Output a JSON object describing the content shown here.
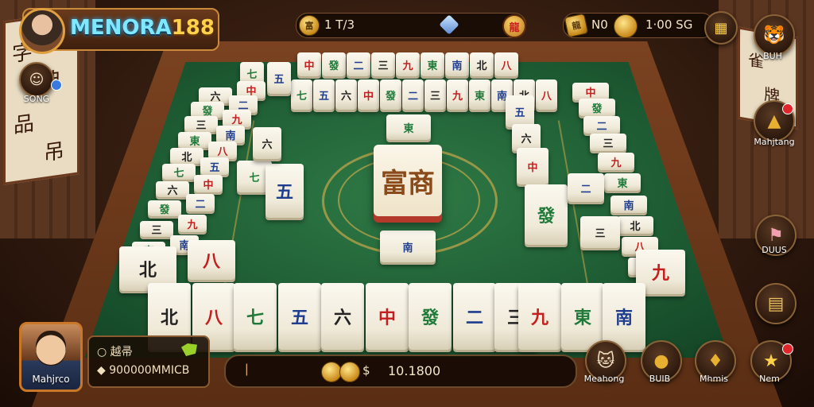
{
  "logo": {
    "text_a": "MENORA",
    "text_b": "188"
  },
  "top_hud": {
    "coin_icon_label": "富",
    "coins_text": "1 T/3",
    "rank_badge_label": "龍",
    "right_text_a": "龍",
    "right_text_b": "N0",
    "right_text_c": "1·00  SG"
  },
  "left_player": {
    "name": "SONG"
  },
  "right_menu": [
    {
      "label": "BUH",
      "icon": "tiger-mascot-icon"
    },
    {
      "label": "Mahjtang",
      "icon": "gold-ingot-icon"
    },
    {
      "label": "DUUS",
      "icon": "flag-icon"
    },
    {
      "label": "",
      "icon": "scroll-icon"
    }
  ],
  "bottom_buttons": [
    {
      "label": "Meahong",
      "icon": "lucky-cat-icon"
    },
    {
      "label": "BUIB",
      "icon": "gold-pouch-icon"
    },
    {
      "label": "Mhmis",
      "icon": "money-bag-icon"
    },
    {
      "label": "Nem",
      "icon": "star-icon"
    }
  ],
  "bottom_player": {
    "name": "Mahjrco"
  },
  "info_box": {
    "line1": "○ 越帚",
    "line2": "◆ 900000MMICB"
  },
  "score_bar": {
    "marker": "❘",
    "label": "$ ",
    "value": "10.1800"
  },
  "center_tile": {
    "glyph": "富商"
  },
  "colors": {
    "felt": "#1d5a32",
    "accent_gold": "#c8a84a",
    "tile_red": "#c41e1e",
    "tile_green": "#1f7a3a"
  }
}
